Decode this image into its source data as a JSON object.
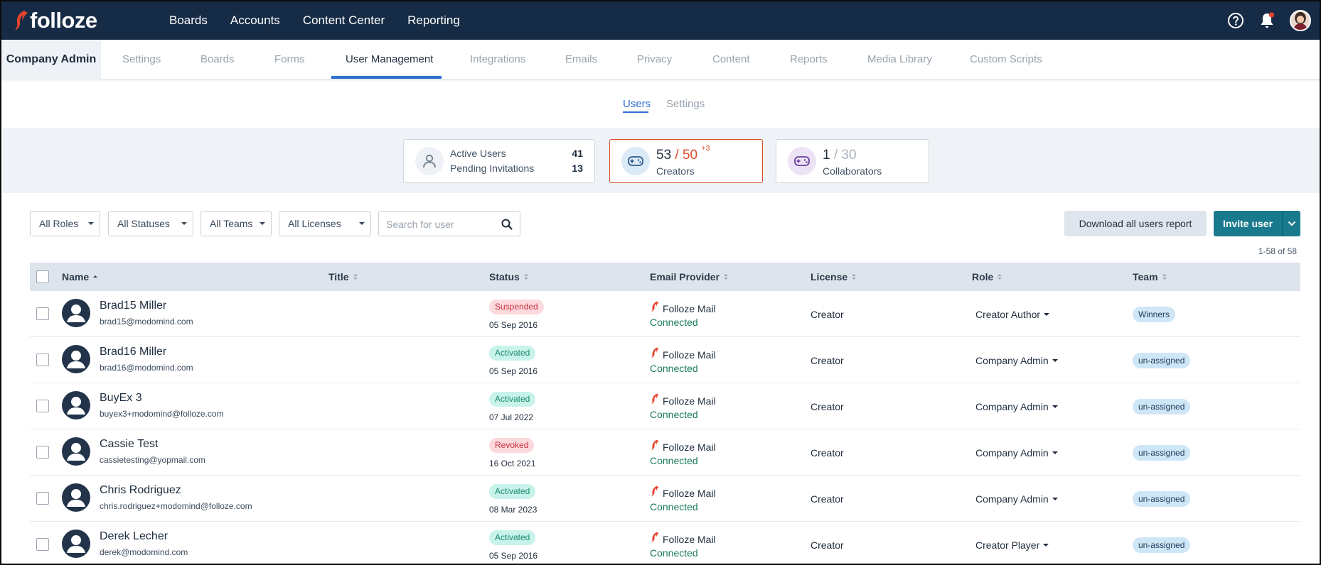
{
  "brand": {
    "name": "folloze",
    "accent": "#e8432e",
    "topbar_bg": "#162b45"
  },
  "topnav": {
    "items": [
      "Boards",
      "Accounts",
      "Content Center",
      "Reporting"
    ],
    "icons": [
      "help-icon",
      "bell-icon",
      "avatar"
    ]
  },
  "admin": {
    "title": "Company Admin",
    "tabs": [
      "Settings",
      "Boards",
      "Forms",
      "User Management",
      "Integrations",
      "Emails",
      "Privacy",
      "Content",
      "Reports",
      "Media Library",
      "Custom Scripts"
    ],
    "active_tab": "User Management"
  },
  "subtabs": {
    "users": "Users",
    "settings": "Settings",
    "active": "Users"
  },
  "stats": {
    "active_users_label": "Active Users",
    "active_users_value": "41",
    "pending_label": "Pending Invitations",
    "pending_value": "13",
    "creators_used": "53",
    "creators_sep": " / ",
    "creators_total": "50",
    "creators_extra": "+3",
    "creators_label": "Creators",
    "collab_used": "1",
    "collab_total": " / 30",
    "collab_label": "Collaborators"
  },
  "filters": {
    "roles": "All Roles",
    "statuses": "All Statuses",
    "teams": "All Teams",
    "licenses": "All Licenses",
    "search_placeholder": "Search for user"
  },
  "actions": {
    "download": "Download all users report",
    "invite": "Invite user"
  },
  "count_text": "1-58 of 58",
  "table": {
    "columns": [
      "Name",
      "Title",
      "Status",
      "Email Provider",
      "License",
      "Role",
      "Team"
    ],
    "sorted_column": "Name",
    "rows": [
      {
        "name": "Brad15 Miller",
        "email": "brad15@modomind.com",
        "title": "",
        "status": "Suspended",
        "status_date": "05 Sep 2016",
        "provider": "Folloze Mail",
        "provider_status": "Connected",
        "license": "Creator",
        "role": "Creator Author",
        "team": "Winners"
      },
      {
        "name": "Brad16 Miller",
        "email": "brad16@modomind.com",
        "title": "",
        "status": "Activated",
        "status_date": "05 Sep 2016",
        "provider": "Folloze Mail",
        "provider_status": "Connected",
        "license": "Creator",
        "role": "Company Admin",
        "team": "un-assigned"
      },
      {
        "name": "BuyEx 3",
        "email": "buyex3+modomind@folloze.com",
        "title": "",
        "status": "Activated",
        "status_date": "07 Jul 2022",
        "provider": "Folloze Mail",
        "provider_status": "Connected",
        "license": "Creator",
        "role": "Company Admin",
        "team": "un-assigned"
      },
      {
        "name": "Cassie Test",
        "email": "cassietesting@yopmail.com",
        "title": "",
        "status": "Revoked",
        "status_date": "16 Oct 2021",
        "provider": "Folloze Mail",
        "provider_status": "Connected",
        "license": "Creator",
        "role": "Company Admin",
        "team": "un-assigned"
      },
      {
        "name": "Chris Rodriguez",
        "email": "chris.rodriguez+modomind@folloze.com",
        "title": "",
        "status": "Activated",
        "status_date": "08 Mar 2023",
        "provider": "Folloze Mail",
        "provider_status": "Connected",
        "license": "Creator",
        "role": "Company Admin",
        "team": "un-assigned"
      },
      {
        "name": "Derek Lecher",
        "email": "derek@modomind.com",
        "title": "",
        "status": "Activated",
        "status_date": "05 Sep 2016",
        "provider": "Folloze Mail",
        "provider_status": "Connected",
        "license": "Creator",
        "role": "Creator Player",
        "team": "un-assigned"
      }
    ]
  }
}
